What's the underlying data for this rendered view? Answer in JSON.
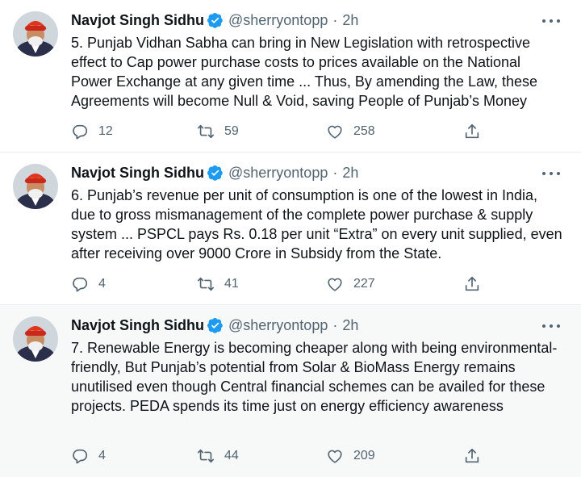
{
  "tweets": [
    {
      "name": "Navjot Singh Sidhu",
      "handle": "@sherryontopp",
      "separator": "·",
      "time": "2h",
      "text": "5. Punjab Vidhan Sabha can bring in New Legislation with retrospective effect to Cap power purchase costs to prices available on the National Power Exchange at any given time ... Thus, By amending the Law, these Agreements will become Null & Void, saving People of Punjab’s Money",
      "replies": "12",
      "retweets": "59",
      "likes": "258"
    },
    {
      "name": "Navjot Singh Sidhu",
      "handle": "@sherryontopp",
      "separator": "·",
      "time": "2h",
      "text": "6. Punjab’s revenue per unit of consumption is one of the lowest in India, due to gross mismanagement of the complete power purchase & supply system ... PSPCL pays Rs. 0.18 per unit “Extra” on every unit supplied, even after receiving over 9000 Crore in Subsidy from the State.",
      "replies": "4",
      "retweets": "41",
      "likes": "227"
    },
    {
      "name": "Navjot Singh Sidhu",
      "handle": "@sherryontopp",
      "separator": "·",
      "time": "2h",
      "text": "7. Renewable Energy is becoming cheaper along with being environmental-friendly, But Punjab’s potential from Solar & BioMass Energy remains unutilised even though Central financial schemes can be availed for these projects. PEDA spends its time just on energy efficiency awareness",
      "replies": "4",
      "retweets": "44",
      "likes": "209"
    }
  ],
  "colors": {
    "verified": "#1d9bf0",
    "secondary_text": "#536471",
    "highlight_bg": "#f7f9f9",
    "turban": "#e0341c"
  },
  "icons": [
    "verified-badge-icon",
    "more-icon",
    "reply-icon",
    "retweet-icon",
    "like-icon",
    "share-icon"
  ]
}
